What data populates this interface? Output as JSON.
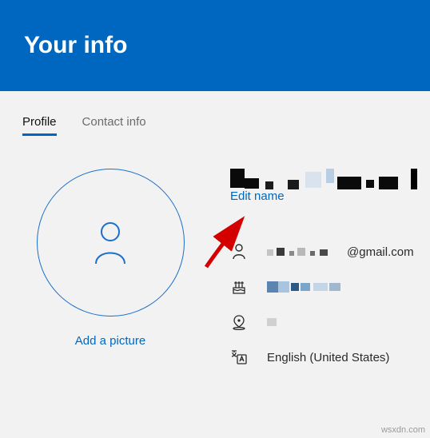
{
  "header": {
    "title": "Your info"
  },
  "tabs": {
    "profile": "Profile",
    "contact": "Contact info"
  },
  "avatar": {
    "add_picture": "Add a picture"
  },
  "info": {
    "edit_name": "Edit name",
    "name_redacted": true,
    "email_suffix": "@gmail.com",
    "birthday_redacted": true,
    "region_redacted": true,
    "language": "English (United States)"
  },
  "watermark": "wsxdn.com"
}
